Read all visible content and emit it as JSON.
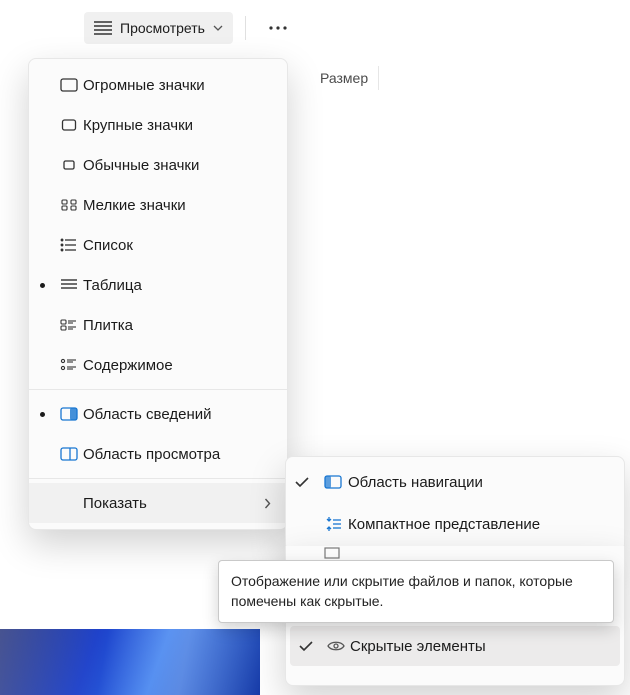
{
  "toolbar": {
    "view_label": "Просмотреть"
  },
  "column": {
    "size": "Размер"
  },
  "menu1": {
    "items": [
      {
        "label": "Огромные значки",
        "icon": "huge-icons"
      },
      {
        "label": "Крупные значки",
        "icon": "large-icons"
      },
      {
        "label": "Обычные значки",
        "icon": "medium-icons"
      },
      {
        "label": "Мелкие значки",
        "icon": "small-icons"
      },
      {
        "label": "Список",
        "icon": "list-icon"
      },
      {
        "label": "Таблица",
        "icon": "details-icon",
        "checked": true
      },
      {
        "label": "Плитка",
        "icon": "tiles-icon"
      },
      {
        "label": "Содержимое",
        "icon": "content-icon"
      }
    ],
    "panes": [
      {
        "label": "Область сведений",
        "icon": "details-pane-icon",
        "checked": true
      },
      {
        "label": "Область просмотра",
        "icon": "preview-pane-icon"
      }
    ],
    "show_label": "Показать"
  },
  "menu2": {
    "items": [
      {
        "label": "Область навигации",
        "icon": "nav-pane-icon",
        "checked": true
      },
      {
        "label": "Компактное представление",
        "icon": "compact-view-icon"
      },
      {
        "label": "",
        "icon": "placeholder-icon"
      },
      {
        "label": "Скрытые элементы",
        "icon": "hidden-items-icon",
        "checked": true,
        "hover": true
      }
    ]
  },
  "tooltip": {
    "text": "Отображение или скрытие файлов и папок, которые помечены как скрытые."
  }
}
